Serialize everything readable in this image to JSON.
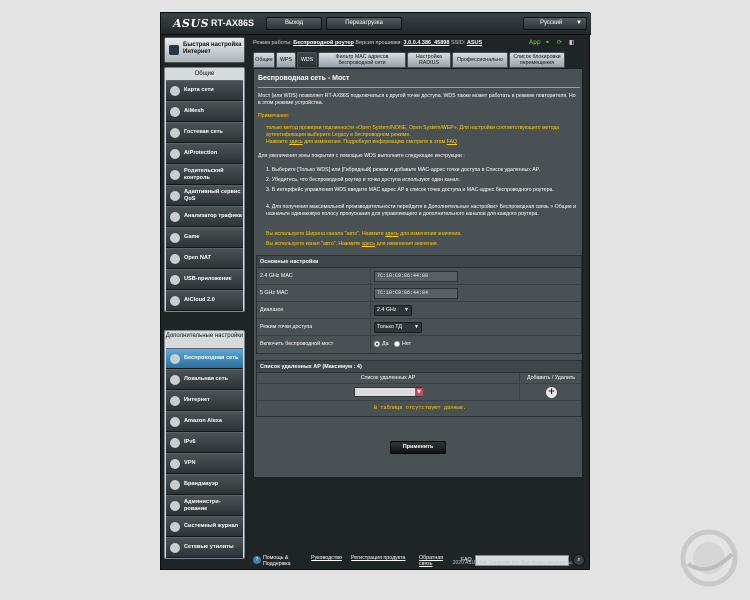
{
  "header": {
    "brand": "ASUS",
    "model": "RT-AX86S",
    "logout": "Выход",
    "reboot": "Перезагрузка",
    "language": "Русский"
  },
  "sidebar": {
    "quick_setup": "Быстрая настройка Интернет",
    "general_title": "Общие",
    "general_items": [
      {
        "label": "Карта сети",
        "icon": "network-map-icon"
      },
      {
        "label": "AiMesh",
        "icon": "aimesh-icon"
      },
      {
        "label": "Гостевая сеть",
        "icon": "guest-network-icon"
      },
      {
        "label": "AiProtection",
        "icon": "aiprotection-icon"
      },
      {
        "label": "Родительский контроль",
        "icon": "parental-control-icon"
      },
      {
        "label": "Адаптивный сервис QoS",
        "icon": "qos-icon"
      },
      {
        "label": "Анализатор трафика",
        "icon": "traffic-analyzer-icon"
      },
      {
        "label": "Game",
        "icon": "game-icon"
      },
      {
        "label": "Open NAT",
        "icon": "open-nat-icon"
      },
      {
        "label": "USB-приложение",
        "icon": "usb-icon"
      },
      {
        "label": "AiCloud 2.0",
        "icon": "aicloud-icon"
      }
    ],
    "advanced_title": "Дополнительные настройки",
    "advanced_items": [
      {
        "label": "Беспроводная сеть",
        "icon": "wireless-icon",
        "active": true
      },
      {
        "label": "Локальная сеть",
        "icon": "lan-icon"
      },
      {
        "label": "Интернет",
        "icon": "wan-icon"
      },
      {
        "label": "Amazon Alexa",
        "icon": "alexa-icon"
      },
      {
        "label": "IPv6",
        "icon": "ipv6-icon"
      },
      {
        "label": "VPN",
        "icon": "vpn-icon"
      },
      {
        "label": "Брандмауэр",
        "icon": "firewall-icon"
      },
      {
        "label": "Администри-рование",
        "icon": "administration-icon"
      },
      {
        "label": "Системный журнал",
        "icon": "system-log-icon"
      },
      {
        "label": "Сетевые утилиты",
        "icon": "network-tools-icon"
      }
    ]
  },
  "status": {
    "mode_label": "Режим работы:",
    "mode_value": "Беспроводной роутер",
    "firmware_label": "Версия прошивки:",
    "firmware_value": "3.0.0.4.386_45898",
    "ssid_label": "SSID:",
    "ssid_value": "ASUS",
    "app_label": "App"
  },
  "tabs": [
    "Общие",
    "WPS",
    "WDS",
    "Фильтр MAC адресов беспроводной сети",
    "Настройка RADIUS",
    "Профессионально",
    "Список блокировки перемещения"
  ],
  "page": {
    "title": "Беспроводная сеть - Мост",
    "intro": "Мост (или WDS) позволяет RT-AX86S подключаться к другой точке доступа. WDS также может работать в режиме повторителя. Но в этом режиме устройства.",
    "note_title": "Примечание:",
    "note_1": "только метод проверки подлинности «Open System/NONE, Open System/WEP». Для настройки соответствующего метода аутентификации выберите Legacy в беспроводном режиме.",
    "note_2_a": "Нажмите ",
    "note_2_link": "здесь",
    "note_2_b": " для изменения. Подробную информацию смотрите в этом ",
    "note_2_faq": "FAQ",
    "steps_title": "Для увеличения зоны покрытия с помощью WDS выполните следующие инструкции :",
    "step_1": "1. Выберите [Только WDS] или [Гибридный] режим и добавьте MAC-адрес точки доступа в Список удаленных AP.",
    "step_2": "2. Убедитесь, что беспроводной роутер и точка доступа используют один канал.",
    "step_3": "3. В интерфейс управления WDS введите MAC адрес AP в список точек доступа и MAC-адрес беспроводного роутера.",
    "step_4": "4. Для получения максимальной производительности перейдите в Дополнительные настройки> Беспроводная связь > Общие и назначьте одинаковую полосу пропускания для управляющего и дополнительного каналов для каждого роутера.",
    "warn_1_a": "Вы используете Ширина канала \"авто\". Нажмите ",
    "warn_1_link": "здесь",
    "warn_1_b": " для изменения значения.",
    "warn_2_a": "Вы используете канал \"авто\". Нажмите ",
    "warn_2_link": "здесь",
    "warn_2_b": " для изменения значения."
  },
  "basic": {
    "header": "Основные настройки",
    "mac24_label": "2.4 GHz MAC",
    "mac24_value": "7C:10:C9:86:44:80",
    "mac5_label": "5 GHz MAC",
    "mac5_value": "7C:10:C9:86:44:84",
    "band_label": "Диапазон",
    "band_value": "2.4 GHz",
    "ap_mode_label": "Режим точки доступа",
    "ap_mode_value": "Только ТД",
    "bridge_label": "Включить беспроводной мост",
    "yes": "Да",
    "no": "Нет"
  },
  "remote_ap": {
    "header": "Список удаленных AP (Максимум : 4)",
    "col_list": "Список удаленных AP",
    "col_action": "Добавить / Удалить",
    "empty": "В таблице отсутствуют данные."
  },
  "apply_label": "Применить",
  "footer": {
    "help": "Помощь & Поддержка",
    "manual": "Руководство",
    "register": "Регистрация продукта",
    "feedback": "Обратная связь",
    "faq": "FAQ",
    "copyright": "2020 ASUSTeK Computer Inc. Все права защищены."
  },
  "colors": {
    "accent_blue": "#3b8ec4",
    "warning_yellow": "#ffcc00",
    "panel": "#4a5155"
  }
}
